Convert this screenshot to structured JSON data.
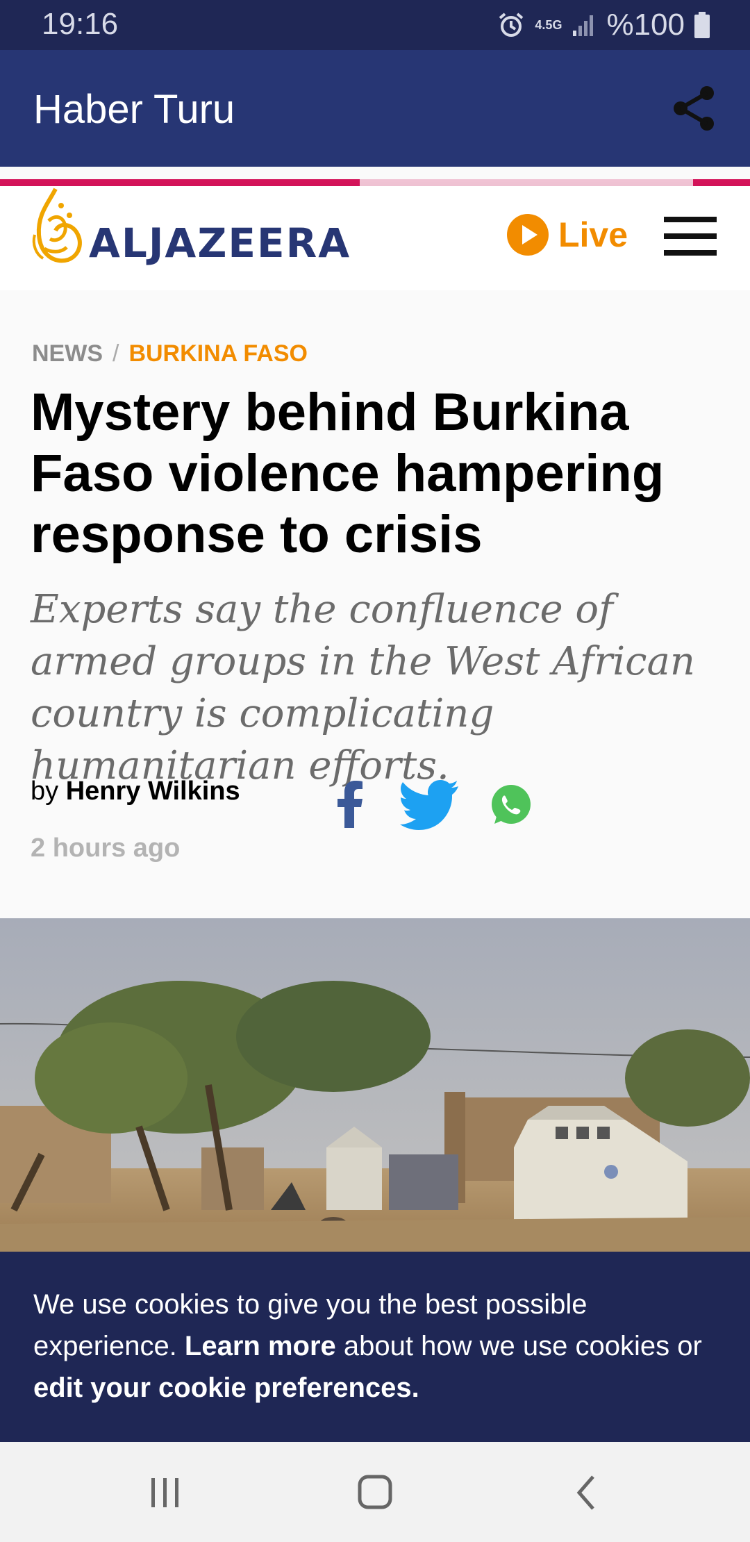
{
  "status_bar": {
    "time": "19:16",
    "network": "4.5G",
    "battery": "%100"
  },
  "app_bar": {
    "title": "Haber Turu",
    "share_icon": "share-icon"
  },
  "site_header": {
    "logo_text": "ALJAZEERA",
    "live_label": "Live",
    "menu_icon": "hamburger-menu-icon",
    "colors": {
      "brand": "#273674",
      "accent": "#f28c00",
      "logo_gold": "#f0a500"
    }
  },
  "article": {
    "breadcrumb": {
      "section": "NEWS",
      "separator": "/",
      "topic": "BURKINA FASO"
    },
    "headline": "Mystery behind Burkina Faso violence hampering response to crisis",
    "standfirst": "Experts say the confluence of armed groups in the West African country is complicating humanitarian efforts.",
    "byline_prefix": "by",
    "author": "Henry Wilkins",
    "time_ago": "2 hours ago",
    "share_buttons": [
      "facebook-icon",
      "twitter-icon",
      "whatsapp-icon"
    ]
  },
  "cookie_banner": {
    "text_1": "We use cookies to give you the best possible experience.",
    "link_1": "Learn more",
    "text_2": "about how we use cookies or",
    "link_2": "edit your cookie preferences."
  },
  "nav_bar": {
    "buttons": [
      "recent-apps-icon",
      "home-icon",
      "back-icon"
    ]
  }
}
